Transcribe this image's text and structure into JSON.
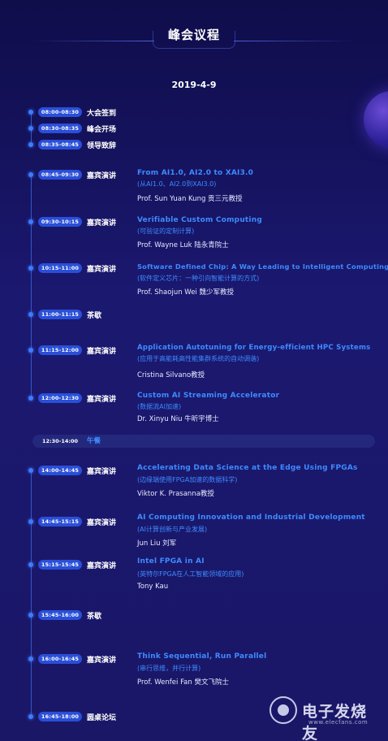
{
  "title": "峰会议程",
  "date": "2019-4-9",
  "colors": {
    "background": "#1a1767",
    "accent": "#3d8bff",
    "pill": "#2a4fd8"
  },
  "agenda": [
    {
      "time": "08:00-08:30",
      "type": "大会签到"
    },
    {
      "time": "08:30-08:35",
      "type": "峰会开场"
    },
    {
      "time": "08:35-08:45",
      "type": "领导致辞"
    },
    {
      "time": "08:45-09:30",
      "type": "嘉宾演讲",
      "title": "From AI1.0, AI2.0 to XAI3.0",
      "subtitle": "(从AI1.0、AI2.0到XAI3.0)",
      "speaker": "Prof. Sun Yuan Kung 贡三元教授"
    },
    {
      "time": "09:30-10:15",
      "type": "嘉宾演讲",
      "title": "Verifiable Custom Computing",
      "subtitle": "(可验证的定制计算)",
      "speaker": "Prof. Wayne Luk 陆永青院士"
    },
    {
      "time": "10:15-11:00",
      "type": "嘉宾演讲",
      "title": "Software Defined Chip: A Way Leading to Intelligent Computing",
      "subtitle": "(软件定义芯片：一种引向智能计算的方式)",
      "speaker": "Prof. Shaojun Wei 魏少军教授"
    },
    {
      "time": "11:00-11:15",
      "type": "茶歇"
    },
    {
      "time": "11:15-12:00",
      "type": "嘉宾演讲",
      "title": "Application Autotuning for Energy-efficient HPC Systems",
      "subtitle": "(应用于高能耗高性能集群系统的自动调谐)",
      "speaker": "Cristina Silvano教授"
    },
    {
      "time": "12:00-12:30",
      "type": "嘉宾演讲",
      "title": "Custom AI Streaming Accelerator",
      "subtitle": "(数据流AI加速)",
      "speaker": "Dr. Xinyu Niu 牛昕宇博士"
    },
    {
      "time": "14:00-14:45",
      "type": "嘉宾演讲",
      "title": "Accelerating Data Science at the Edge Using FPGAs",
      "subtitle": "(边缘端使用FPGA加速的数据科学)",
      "speaker": "Viktor K. Prasanna教授"
    },
    {
      "time": "14:45-15:15",
      "type": "嘉宾演讲",
      "title": "AI Computing Innovation and Industrial Development",
      "subtitle": "(AI计算创新与产业发展)",
      "speaker": "Jun Liu 刘军"
    },
    {
      "time": "15:15-15:45",
      "type": "嘉宾演讲",
      "title": "Intel FPGA in AI",
      "subtitle": "(英特尔FPGA在人工智能领域的应用)",
      "speaker": "Tony Kau"
    },
    {
      "time": "15:45-16:00",
      "type": "茶歇"
    },
    {
      "time": "16:00-16:45",
      "type": "嘉宾演讲",
      "title": "Think Sequential, Run Parallel",
      "subtitle": "(串行思维，并行计算)",
      "speaker": "Prof. Wenfei Fan 樊文飞院士"
    },
    {
      "time": "16:45-18:00",
      "type": "圆桌论坛"
    }
  ],
  "lunch": {
    "time": "12:30-14:00",
    "label": "午餐"
  },
  "logo": {
    "text": "电子发烧友",
    "url": "www.elecfans.com"
  }
}
